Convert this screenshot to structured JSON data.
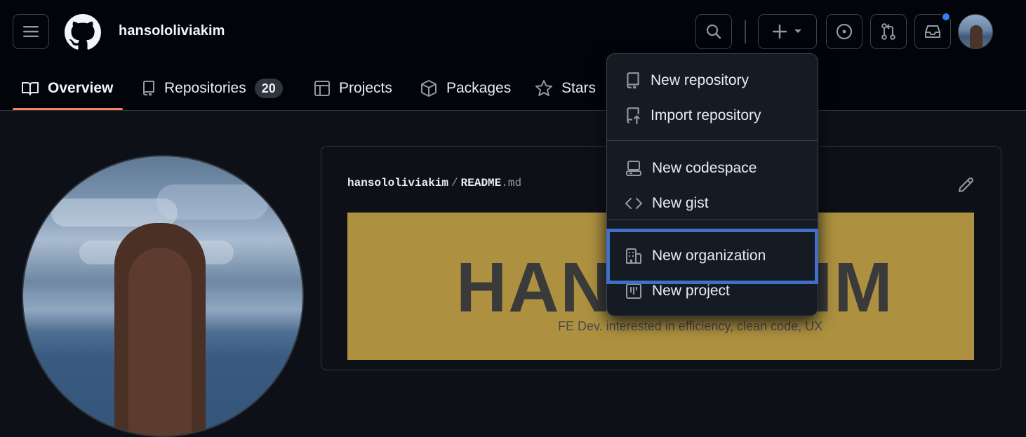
{
  "header": {
    "username": "hansololiviakim",
    "icons": {
      "menu": "hamburger-icon",
      "logo": "github-logo-icon",
      "search": "search-icon",
      "create": "plus-icon",
      "issues": "issue-opened-icon",
      "pull_requests": "git-pull-request-icon",
      "inbox": "inbox-icon"
    },
    "notification_color": "#2f81f7"
  },
  "tabs": [
    {
      "label": "Overview",
      "icon": "book-icon",
      "active": true
    },
    {
      "label": "Repositories",
      "icon": "repo-icon",
      "count": "20"
    },
    {
      "label": "Projects",
      "icon": "table-icon"
    },
    {
      "label": "Packages",
      "icon": "package-icon"
    },
    {
      "label": "Stars",
      "icon": "star-icon"
    }
  ],
  "readme": {
    "owner": "hansololiviakim",
    "separator": "/",
    "file_name": "README",
    "file_ext": ".md",
    "banner_title": "HANSOLKIM",
    "banner_subtitle": "FE Dev. interested in efficiency, clean code, UX",
    "banner_color": "#ad9140"
  },
  "create_menu": {
    "items": [
      {
        "label": "New repository",
        "icon": "repo-icon"
      },
      {
        "label": "Import repository",
        "icon": "repo-push-icon"
      },
      {
        "label": "New codespace",
        "icon": "codespaces-icon"
      },
      {
        "label": "New gist",
        "icon": "code-icon"
      },
      {
        "label": "New organization",
        "icon": "organization-icon",
        "highlighted": true
      },
      {
        "label": "New project",
        "icon": "project-icon"
      }
    ],
    "highlight_color": "#3f6fc6"
  },
  "colors": {
    "background": "#0d1117",
    "header_background": "#010409",
    "active_tab_underline": "#f78166"
  }
}
